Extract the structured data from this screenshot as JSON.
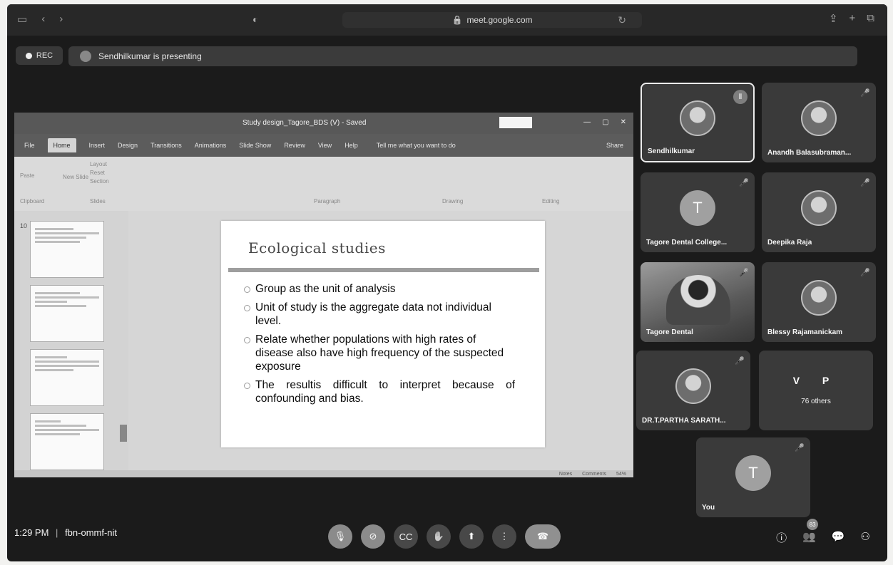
{
  "browser": {
    "url": "meet.google.com"
  },
  "meet_top": {
    "rec_label": "REC",
    "presenting": "Sendhilkumar is presenting"
  },
  "powerpoint": {
    "title": "Study design_Tagore_BDS (V) - Saved",
    "tabs": [
      "File",
      "Home",
      "Insert",
      "Design",
      "Transitions",
      "Animations",
      "Slide Show",
      "Review",
      "View",
      "Help"
    ],
    "tell_me": "Tell me what you want to do",
    "share": "Share",
    "ribbon_groups": [
      "Paste",
      "New Slide",
      "Layout",
      "Reset",
      "Section",
      "Paragraph",
      "Drawing",
      "Editing",
      "Slides",
      "Clipboard"
    ],
    "status": [
      "Notes",
      "Comments",
      "54%"
    ]
  },
  "slide": {
    "title": "Ecological studies",
    "bullets": [
      "Group as the unit of analysis",
      "Unit of study is the aggregate data not individual level.",
      "Relate whether populations with high rates of disease also have high frequency of the suspected exposure",
      "The resultis difficult to interpret because of confounding and bias."
    ]
  },
  "thumbnails": {
    "current_number": "10"
  },
  "participants": [
    {
      "name": "Sendhilkumar",
      "avatar": "photo",
      "status": "speaking"
    },
    {
      "name": "Anandh Balasubraman...",
      "avatar": "photo",
      "status": "muted"
    },
    {
      "name": "Tagore Dental College...",
      "avatar": "T",
      "status": "muted"
    },
    {
      "name": "Deepika Raja",
      "avatar": "photo",
      "status": "muted"
    },
    {
      "name": "Tagore Dental",
      "avatar": "video",
      "status": "muted"
    },
    {
      "name": "Blessy Rajamanickam",
      "avatar": "photo",
      "status": "muted"
    },
    {
      "name": "DR.T.PARTHA SARATH...",
      "avatar": "photo",
      "status": "muted"
    },
    {
      "name": "V P",
      "others": "76 others"
    },
    {
      "name": "You",
      "avatar": "T",
      "status": "muted"
    }
  ],
  "bottom": {
    "time": "1:29 PM",
    "separator": "|",
    "meeting_code": "fbn-ommf-nit",
    "participant_count": "83",
    "controls": [
      "microphone",
      "camera",
      "captions",
      "raise-hand",
      "present",
      "more-options",
      "leave-call"
    ]
  },
  "icons": {
    "mic_off": "🎙",
    "cam_off": "⊘",
    "captions": "CC",
    "hand": "✋",
    "present": "⬆",
    "more": "⋮",
    "end": "☎",
    "info": "ⓘ",
    "people": "👥",
    "chat": "💬",
    "activities": "⚇",
    "muted": "🎤"
  }
}
